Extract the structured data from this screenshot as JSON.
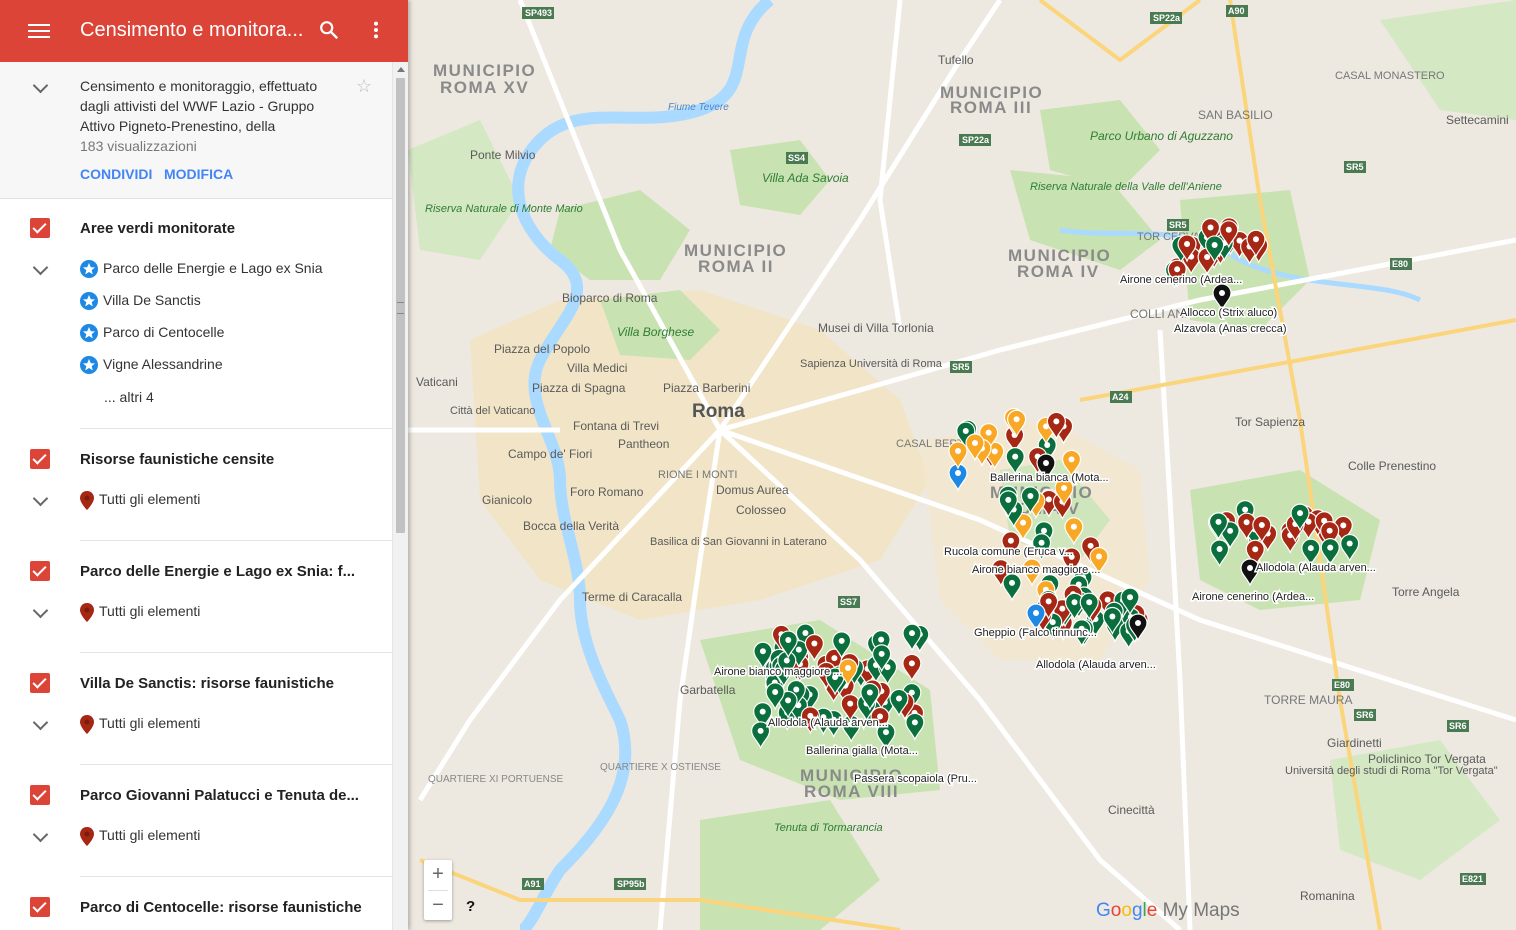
{
  "app": {
    "title": "Censimento e monitora...",
    "description": "Censimento e monitoraggio, effettuato dagli attivisti del WWF Lazio - Gruppo Attivo Pigneto-Prenestino, della",
    "views": "183 visualizzazioni",
    "share_label": "CONDIVIDI",
    "edit_label": "MODIFICA"
  },
  "layers": [
    {
      "title": "Aree verdi monitorate",
      "items": [
        "Parco delle Energie e Lago ex Snia",
        "Villa De Sanctis",
        "Parco di Centocelle",
        "Vigne Alessandrine"
      ],
      "more": "... altri 4"
    },
    {
      "title": "Risorse faunistiche censite",
      "items": [
        "Tutti gli elementi"
      ]
    },
    {
      "title": "Parco delle Energie e Lago ex Snia: f...",
      "items": [
        "Tutti gli elementi"
      ]
    },
    {
      "title": "Villa De Sanctis: risorse faunistiche",
      "items": [
        "Tutti gli elementi"
      ]
    },
    {
      "title": "Parco Giovanni Palatucci e Tenuta de...",
      "items": [
        "Tutti gli elementi"
      ]
    },
    {
      "title": "Parco di Centocelle: risorse faunistiche",
      "items": []
    }
  ],
  "colors": {
    "header": "#db4437",
    "checkbox": "#db4437",
    "link": "#4285f4",
    "pin_red": "#a52714",
    "pin_green": "#0b6e3d",
    "pin_orange": "#f9a825",
    "pin_black": "#111111",
    "pin_blue": "#1e88e5",
    "park": "#c8e6b0",
    "water": "#aadaff",
    "urban": "#f5e7c4"
  },
  "icons": {
    "menu": "menu-icon",
    "search": "search-icon",
    "more": "more-vert-icon",
    "star": "star-outline-icon",
    "area_marker": "blue-star-marker-icon",
    "element_marker": "red-pin-icon"
  },
  "map": {
    "district_labels": [
      {
        "text": "MUNICIPIO"
      },
      {
        "text": "ROMA XV"
      },
      {
        "text": "MUNICIPIO"
      },
      {
        "text": "ROMA III"
      },
      {
        "text": "MUNICIPIO"
      },
      {
        "text": "ROMA II"
      },
      {
        "text": "MUNICIPIO"
      },
      {
        "text": "ROMA IV"
      },
      {
        "text": "MUNICIPIO"
      },
      {
        "text": "ROMA V"
      },
      {
        "text": "MUNICIPIO"
      },
      {
        "text": "ROMA VIII"
      }
    ],
    "place_labels": [
      "Roma",
      "Tufello",
      "SAN BASILIO",
      "CASAL MONASTERO",
      "Settecamini",
      "Ponte Milvio",
      "Parco Urbano di Aguzzano",
      "Villa Ada Savoia",
      "Riserva Naturale di Monte Mario",
      "Riserva Naturale della Valle dell'Aniene",
      "Bioparco di Roma",
      "Villa Borghese",
      "Piazza del Popolo",
      "Villa Medici",
      "Piazza di Spagna",
      "Piazza Barberini",
      "Musei di Villa Torlonia",
      "Sapienza Università di Roma",
      "Fontana di Trevi",
      "Pantheon",
      "Campo de' Fiori",
      "Foro Romano",
      "Domus Aurea",
      "Colosseo",
      "Città del Vaticano",
      "Vaticani",
      "Gianicolo",
      "Bocca della Verità",
      "Basilica di San Giovanni in Laterano",
      "Terme di Caracalla",
      "Garbatella",
      "QUARTIERE X OSTIENSE",
      "QUARTIERE XI PORTUENSE",
      "Tenuta di Tormarancia",
      "Cinecittà",
      "Tor Sapienza",
      "Colle Prenestino",
      "Torre Angela",
      "TORRE MAURA",
      "Giardinetti",
      "Università degli studi di Roma \"Tor Vergata\"",
      "Policlinico Tor Vergata",
      "Romanina",
      "COLLI ANI",
      "TOR CERVARA",
      "CASAL BERT",
      "RIONE I MONTI",
      "Fiume Tevere"
    ],
    "road_shields": [
      "SP493",
      "SP22a",
      "A90",
      "SS4",
      "SP22a",
      "SR5",
      "SR5",
      "SR5",
      "E80",
      "A24",
      "SS7",
      "E80",
      "SR6",
      "SR6",
      "A91",
      "SP95b",
      "E821"
    ],
    "marker_labels": [
      "Airone cenerino (Ardea...",
      "Allocco (Strix aluco)",
      "Alzavola (Anas crecca)",
      "Ballerina bianca (Mota...",
      "Rucola comune (Eruca v...",
      "Airone bianco maggiore ...",
      "Gheppio (Falco tinnunc...",
      "Allodola (Alauda arven...",
      "Airone cenerino (Ardea...",
      "Allodola (Alauda arven...",
      "Airone bianco maggiore ...",
      "Allodola (Alauda arven...",
      "Ballerina gialla (Mota...",
      "Passera scopaiola (Pru..."
    ]
  },
  "controls": {
    "zoom_in": "+",
    "zoom_out": "−",
    "help": "?",
    "logo_google": [
      "G",
      "o",
      "o",
      "g",
      "l",
      "e"
    ],
    "logo_mymaps": " My Maps"
  }
}
